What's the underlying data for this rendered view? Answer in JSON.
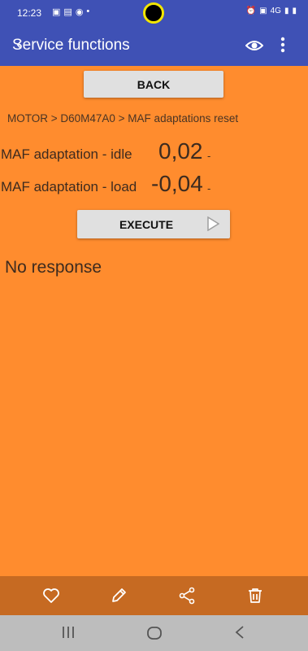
{
  "status_bar": {
    "time": "12:23",
    "left_icons": [
      "▣",
      "▤",
      "◉",
      "•"
    ],
    "right_icons": [
      "⏰",
      "▣",
      "4G",
      "▮",
      "▮"
    ]
  },
  "app_bar": {
    "title": "Service functions",
    "back_icon": "arrow-back-icon",
    "actions": [
      "eye-icon",
      "more-vert-icon"
    ]
  },
  "main": {
    "back_button": "BACK",
    "breadcrumb": "MOTOR > D60M47A0 > MAF adaptations reset",
    "rows": [
      {
        "label": "MAF adaptation - idle",
        "value": "0,02",
        "unit": "-"
      },
      {
        "label": "MAF adaptation - load",
        "value": "-0,04",
        "unit": "-"
      }
    ],
    "execute_button": "EXECUTE",
    "response": "No response"
  },
  "toolbar": {
    "icons": [
      "heart-icon",
      "pencil-icon",
      "share-icon",
      "trash-icon"
    ]
  },
  "nav_bar": {
    "icons": [
      "recents-icon",
      "home-icon",
      "back-icon"
    ]
  },
  "colors": {
    "primary": "#3f51b5",
    "background": "#ff8c2e",
    "toolbar": "#c66a22",
    "nav_bar": "#bdbdbd",
    "button": "#e0e0e0"
  }
}
